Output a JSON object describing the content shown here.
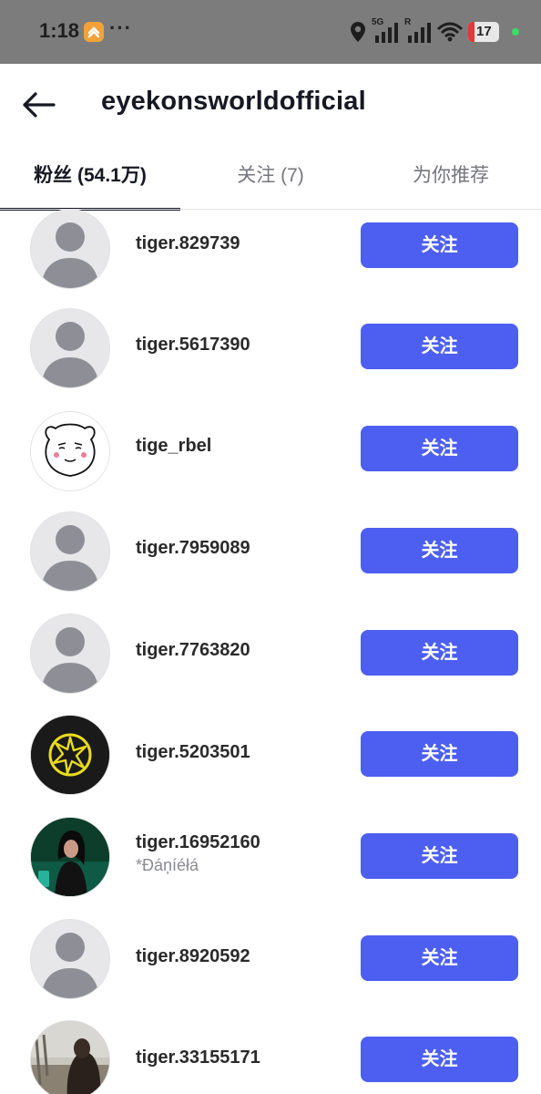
{
  "status_bar": {
    "time": "1:18",
    "more": "···",
    "network_label": "5G",
    "roaming_label": "R",
    "battery": "17",
    "icons": [
      "app-notification-icon",
      "location-icon",
      "signal-icon",
      "signal-roaming-icon",
      "wifi-icon",
      "battery-icon"
    ]
  },
  "header": {
    "back_icon": "arrow-left-icon",
    "title": "eyekonsworldofficial"
  },
  "tabs": [
    {
      "label": "粉丝 (54.1万)",
      "active": true
    },
    {
      "label": "关注 (7)",
      "active": false
    },
    {
      "label": "为你推荐",
      "active": false
    }
  ],
  "follow_label": "关注",
  "users": [
    {
      "username": "tiger.829739",
      "subname": "",
      "avatar": "default-avatar"
    },
    {
      "username": "tiger.5617390",
      "subname": "",
      "avatar": "default-avatar"
    },
    {
      "username": "tige_rbel",
      "subname": "",
      "avatar": "cartoon-bear-face"
    },
    {
      "username": "tiger.7959089",
      "subname": "",
      "avatar": "default-avatar"
    },
    {
      "username": "tiger.7763820",
      "subname": "",
      "avatar": "default-avatar"
    },
    {
      "username": "tiger.5203501",
      "subname": "",
      "avatar": "yellow-star-emblem"
    },
    {
      "username": "tiger.16952160",
      "subname": "*Đáņíéłá",
      "avatar": "photo-woman-green"
    },
    {
      "username": "tiger.8920592",
      "subname": "",
      "avatar": "default-avatar"
    },
    {
      "username": "tiger.33155171",
      "subname": "",
      "avatar": "photo-outdoor-person"
    }
  ],
  "colors": {
    "accent": "#4c5ff0",
    "status_bar": "#7c7c7c",
    "text_primary": "#161823",
    "text_secondary": "#75767d"
  }
}
